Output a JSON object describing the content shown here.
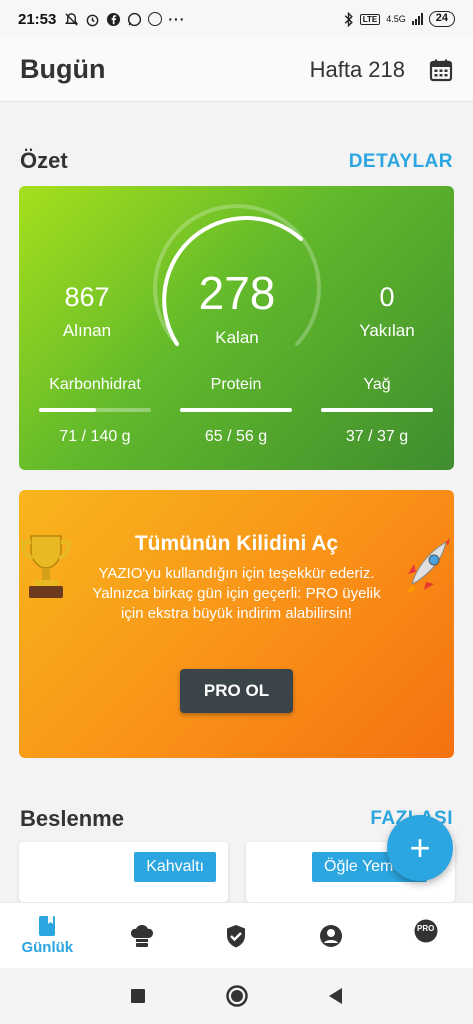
{
  "status": {
    "time": "21:53",
    "dots": "···",
    "network": "4.5G",
    "battery": "24"
  },
  "header": {
    "title": "Bugün",
    "week": "Hafta 218"
  },
  "summary": {
    "section_title": "Özet",
    "details_link": "DETAYLAR",
    "eaten_value": "867",
    "eaten_label": "Alınan",
    "remaining_value": "278",
    "remaining_label": "Kalan",
    "burned_value": "0",
    "burned_label": "Yakılan",
    "macros": [
      {
        "label": "Karbonhidrat",
        "value": "71 / 140 g",
        "progress": 0.51
      },
      {
        "label": "Protein",
        "value": "65 / 56 g",
        "progress": 1.0
      },
      {
        "label": "Yağ",
        "value": "37 / 37 g",
        "progress": 1.0
      }
    ]
  },
  "promo": {
    "title": "Tümünün Kilidini Aç",
    "text": "YAZIO'yu kullandığın için teşekkür ederiz. Yalnızca birkaç gün için geçerli: PRO üyelik için ekstra büyük indirim alabilirsin!",
    "button": "PRO OL"
  },
  "nutrition": {
    "section_title": "Beslenme",
    "more_link": "FAZLASI",
    "meals": [
      "Kahvaltı",
      "Öğle Yemeği"
    ]
  },
  "fab": "+",
  "bottom_nav": {
    "diary_label": "Günlük",
    "pro_badge": "PRO"
  },
  "colors": {
    "accent": "#2ba6e0",
    "summary_start": "#a6e01d",
    "summary_end": "#3f8d2f",
    "promo_start": "#f8b61d",
    "promo_end": "#f5710f",
    "cta": "#3a4449"
  }
}
